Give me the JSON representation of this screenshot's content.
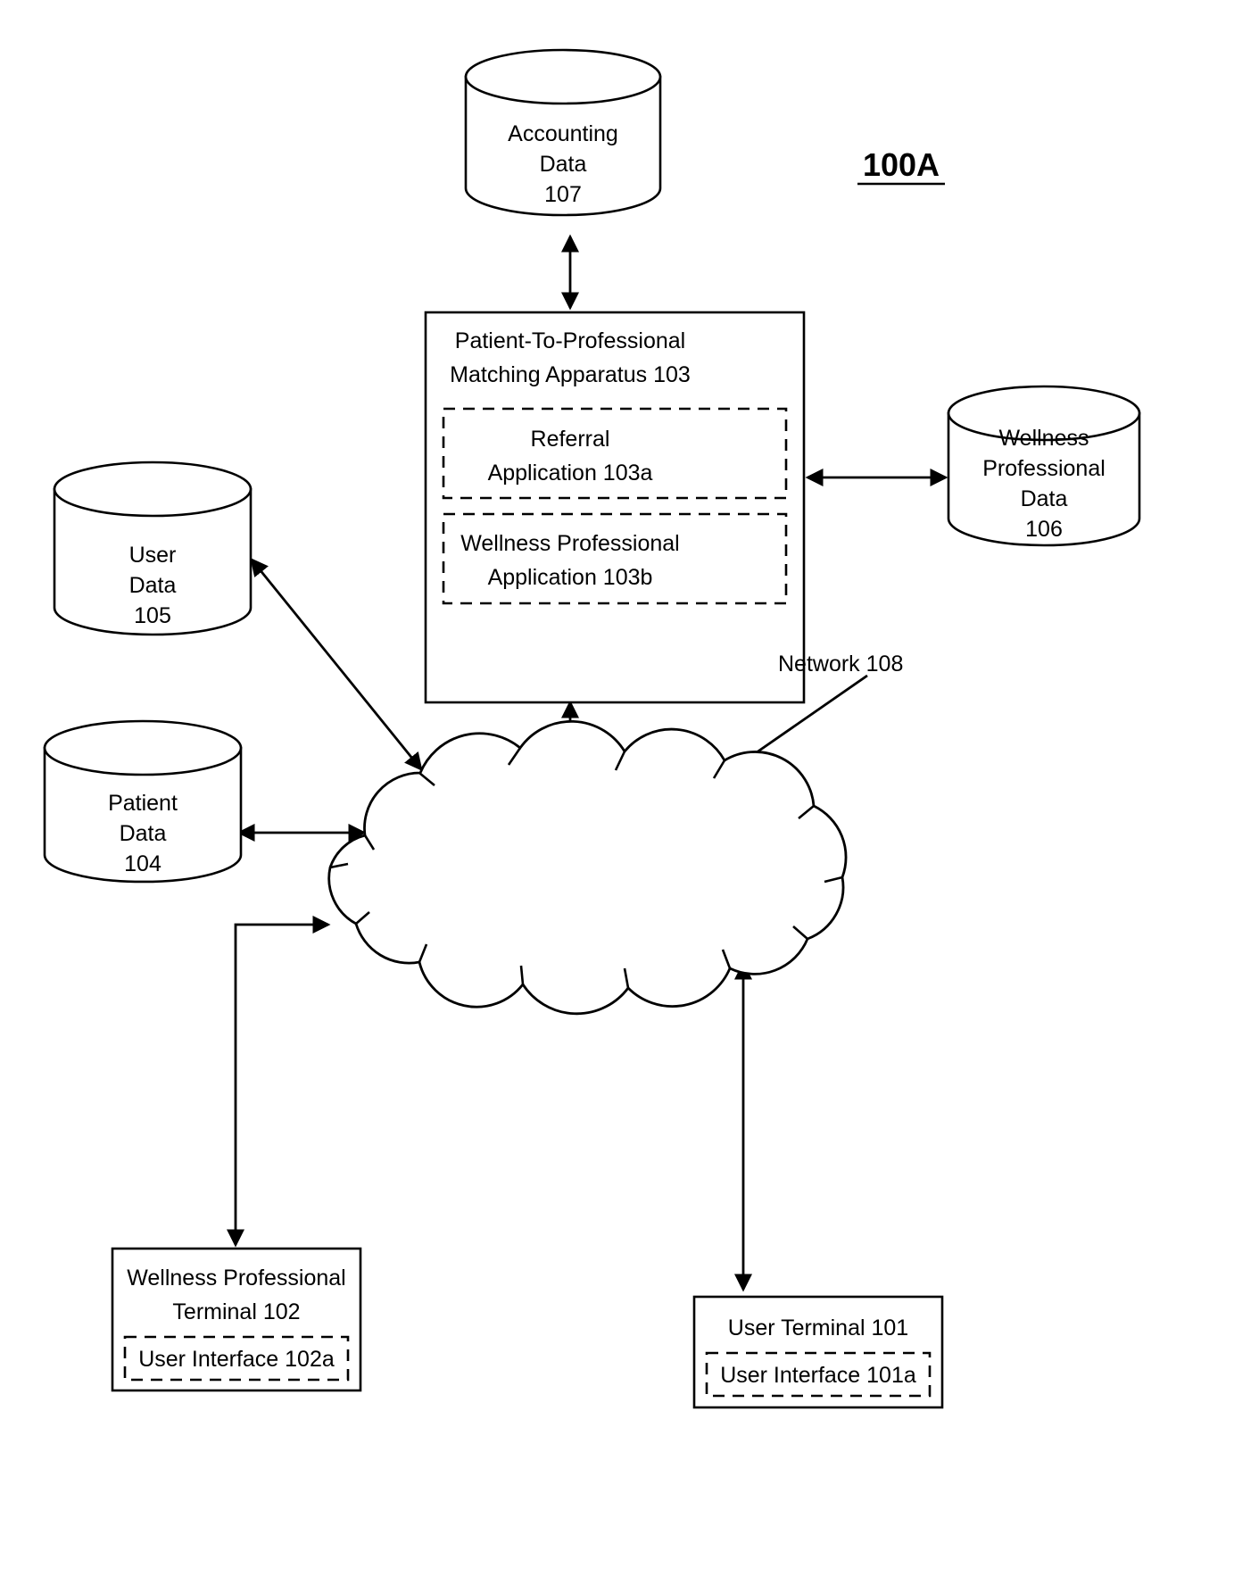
{
  "figure": {
    "label": "100A",
    "label_underlined": true
  },
  "nodes": {
    "accounting_data": {
      "name": "accounting-data-store",
      "lines": [
        "Accounting",
        "Data",
        "107"
      ],
      "ref": "107",
      "shape": "cylinder"
    },
    "matching_apparatus": {
      "name": "patient-to-professional-matching-apparatus",
      "lines": [
        "Patient-To-Professional",
        "Matching Apparatus 103"
      ],
      "ref": "103",
      "shape": "rectangle"
    },
    "referral_application": {
      "name": "referral-application",
      "lines": [
        "Referral",
        "Application 103a"
      ],
      "ref": "103a",
      "shape": "dashed-rectangle"
    },
    "wellness_professional_application": {
      "name": "wellness-professional-application",
      "lines": [
        "Wellness Professional",
        "Application 103b"
      ],
      "ref": "103b",
      "shape": "dashed-rectangle"
    },
    "wellness_professional_data": {
      "name": "wellness-professional-data-store",
      "lines": [
        "Wellness",
        "Professional",
        "Data",
        "106"
      ],
      "ref": "106",
      "shape": "cylinder"
    },
    "user_data": {
      "name": "user-data-store",
      "lines": [
        "User",
        "Data",
        "105"
      ],
      "ref": "105",
      "shape": "cylinder"
    },
    "patient_data": {
      "name": "patient-data-store",
      "lines": [
        "Patient",
        "Data",
        "104"
      ],
      "ref": "104",
      "shape": "cylinder"
    },
    "network": {
      "name": "network-cloud",
      "label": "Network 108",
      "ref": "108",
      "shape": "cloud"
    },
    "wellness_professional_terminal": {
      "name": "wellness-professional-terminal",
      "lines": [
        "Wellness Professional",
        "Terminal 102"
      ],
      "ref": "102",
      "shape": "rectangle"
    },
    "user_interface_102a": {
      "name": "user-interface-102a",
      "label": "User Interface 102a",
      "ref": "102a",
      "shape": "dashed-rectangle"
    },
    "user_terminal": {
      "name": "user-terminal",
      "lines": [
        "User Terminal 101"
      ],
      "ref": "101",
      "shape": "rectangle"
    },
    "user_interface_101a": {
      "name": "user-interface-101a",
      "label": "User Interface 101a",
      "ref": "101a",
      "shape": "dashed-rectangle"
    }
  },
  "connections": [
    {
      "from": "matching_apparatus",
      "to": "accounting_data",
      "arrows": "both"
    },
    {
      "from": "matching_apparatus",
      "to": "wellness_professional_data",
      "arrows": "both"
    },
    {
      "from": "matching_apparatus",
      "to": "network",
      "arrows": "both"
    },
    {
      "from": "network",
      "to": "user_data",
      "arrows": "both"
    },
    {
      "from": "patient_data",
      "to": "network",
      "arrows": "both"
    },
    {
      "from": "network",
      "to": "wellness_professional_terminal",
      "arrows": "to"
    },
    {
      "from": "network",
      "to": "user_terminal",
      "arrows": "both"
    },
    {
      "from": "network_label",
      "to": "network",
      "arrows": "leader"
    }
  ],
  "style": {
    "stroke_color": "#000000",
    "background_color": "#ffffff"
  }
}
